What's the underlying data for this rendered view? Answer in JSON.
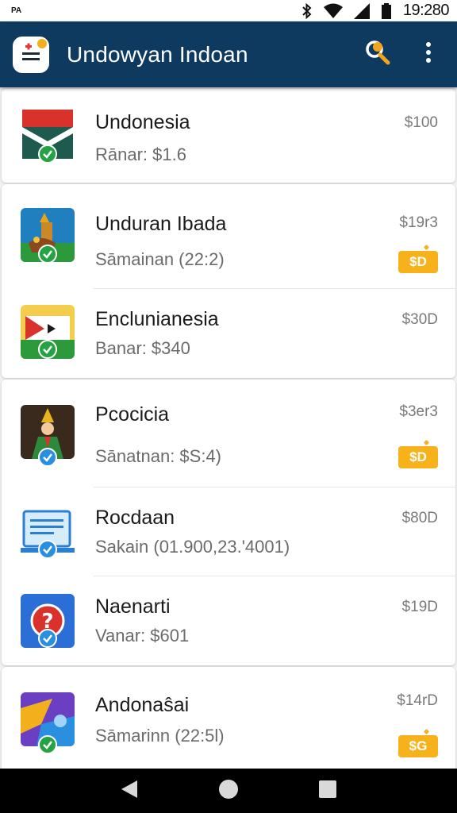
{
  "status_bar": {
    "left_text": "PA",
    "time": "19:280"
  },
  "app_bar": {
    "title": "Undowyan Indoan"
  },
  "items": [
    {
      "title": "Undonesia",
      "subtitle": "Rānar: $1.6",
      "price": "$100",
      "tag": ""
    },
    {
      "title": "Unduran Ibada",
      "subtitle": "Sāmainan (22:2)",
      "price": "$19r3",
      "tag": "$D"
    },
    {
      "title": "Enclunianesia",
      "subtitle": "Banar: $340",
      "price": "$30D",
      "tag": ""
    },
    {
      "title": "Pcocicia",
      "subtitle": "Sānatnan: $S:4)",
      "price": "$3er3",
      "tag": "$D"
    },
    {
      "title": "Rocdaan",
      "subtitle": "Sakain (01.900,23.'4001)",
      "price": "$80D",
      "tag": ""
    },
    {
      "title": "Naenarti",
      "subtitle": "Vanar: $601",
      "price": "$19D",
      "tag": ""
    },
    {
      "title": "Andonaŝai",
      "subtitle": "Sāmarinn (22:5l)",
      "price": "$14rD",
      "tag": "$G"
    }
  ],
  "colors": {
    "app_bar": "#0f3a5f",
    "tag": "#f7b21b",
    "badge_green": "#25a244",
    "badge_blue": "#2b8fe0"
  },
  "icons": {
    "status": [
      "bluetooth-icon",
      "wifi-icon",
      "signal-icon",
      "battery-icon"
    ],
    "app_bar": [
      "app-logo-icon",
      "search-icon",
      "more-vert-icon"
    ],
    "nav": [
      "back-icon",
      "home-icon",
      "recents-icon"
    ]
  }
}
